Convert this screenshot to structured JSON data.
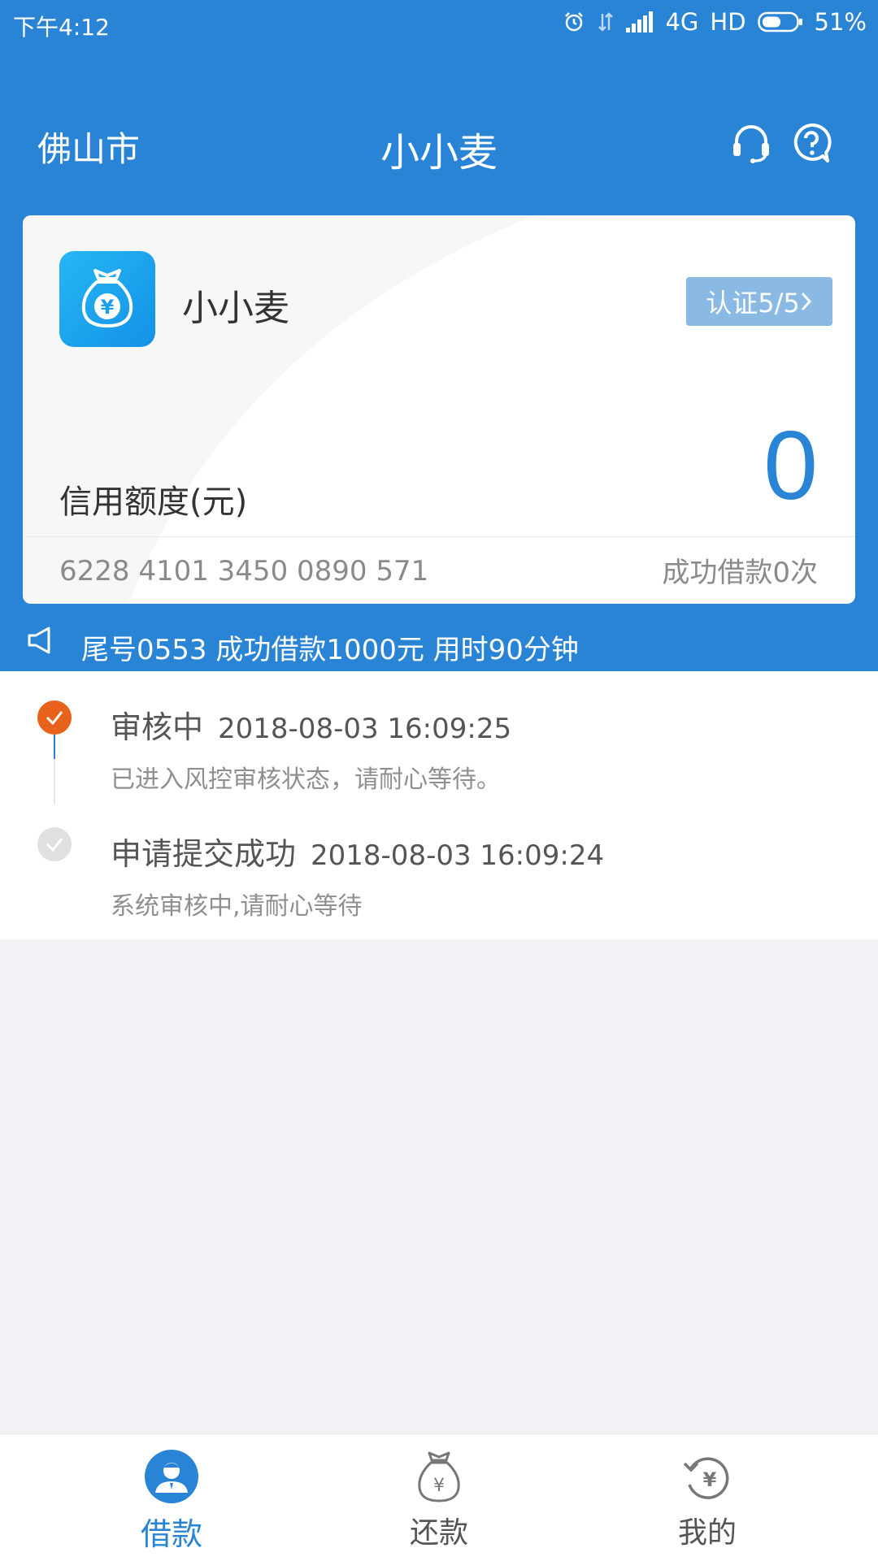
{
  "status_bar": {
    "time": "下午4:12",
    "network": "4G",
    "hd": "HD",
    "battery": "51%",
    "icons": [
      "alarm-icon",
      "data-arrows-icon",
      "signal-icon",
      "battery-icon"
    ]
  },
  "header": {
    "city": "佛山市",
    "title": "小小麦",
    "icons": [
      "headset-icon",
      "help-icon"
    ]
  },
  "card": {
    "app_name": "小小麦",
    "cert_label": "认证5/5",
    "credit_label": "信用额度(元)",
    "credit_value": "0",
    "card_number": "6228 4101 3450 0890 571",
    "loan_count": "成功借款0次"
  },
  "notice": {
    "text": "尾号0553 成功借款1000元 用时90分钟"
  },
  "timeline": [
    {
      "title": "审核中",
      "time": "2018-08-03 16:09:25",
      "desc": "已进入风控审核状态，请耐心等待。",
      "status": "active"
    },
    {
      "title": "申请提交成功",
      "time": "2018-08-03 16:09:24",
      "desc": "系统审核中,请耐心等待",
      "status": "done"
    }
  ],
  "nav": [
    {
      "label": "借款",
      "icon": "borrow-icon",
      "active": true
    },
    {
      "label": "还款",
      "icon": "repay-icon",
      "active": false
    },
    {
      "label": "我的",
      "icon": "mine-icon",
      "active": false
    }
  ],
  "colors": {
    "primary": "#2a84d6",
    "active_dot": "#e8621b",
    "badge": "#8ab9e4",
    "background": "#f0f2f5"
  }
}
